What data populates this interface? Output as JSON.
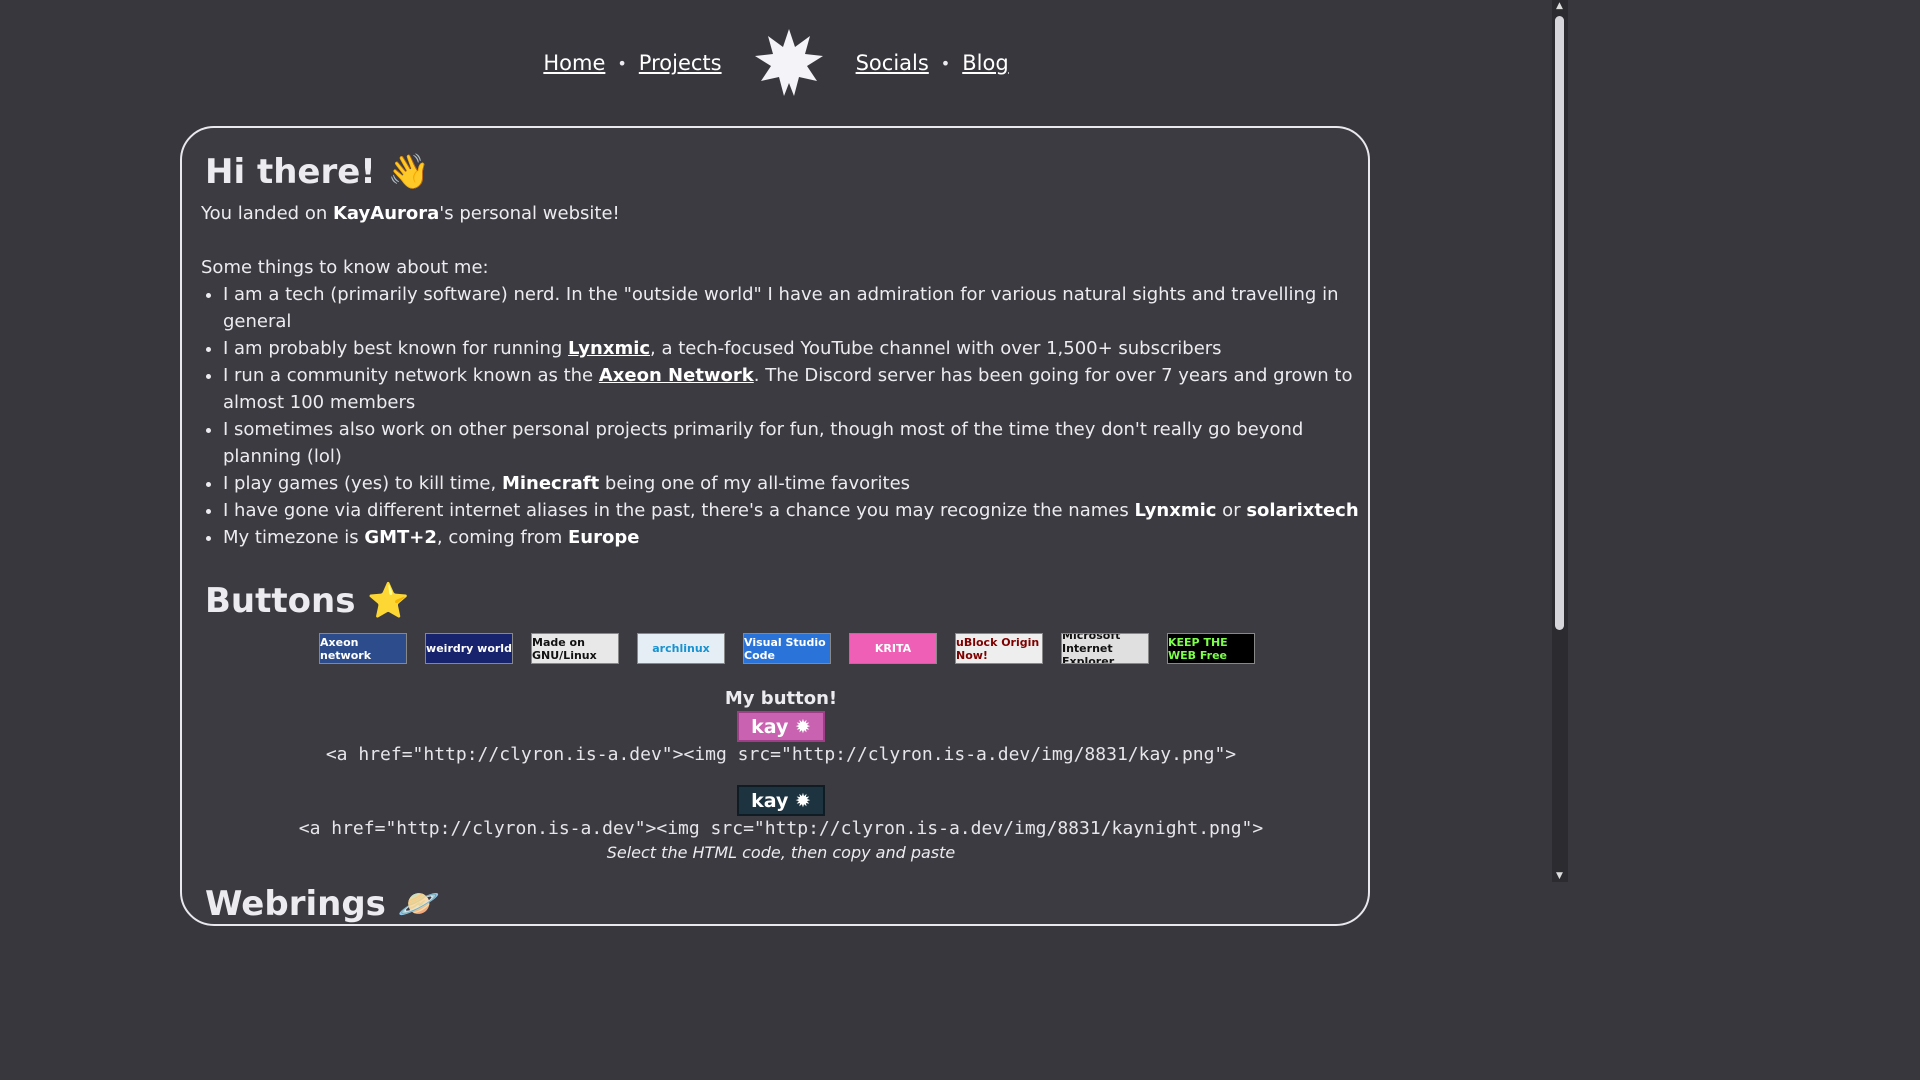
{
  "nav": {
    "home": "Home",
    "projects": "Projects",
    "socials": "Socials",
    "blog": "Blog",
    "separator": "•"
  },
  "intro": {
    "heading": "Hi there! 👋",
    "landed_prefix": "You landed on ",
    "name": "KayAurora",
    "landed_suffix": "'s personal website!",
    "things_label": "Some things to know about me:"
  },
  "facts": {
    "f1": "I am a tech (primarily software) nerd. In the \"outside world\" I have an admiration for various natural sights and travelling in general",
    "f2_a": "I am probably best known for running ",
    "f2_link": "Lynxmic",
    "f2_b": ", a tech-focused YouTube channel with over 1,500+ subscribers",
    "f3_a": "I run a community network known as the ",
    "f3_link": "Axeon Network",
    "f3_b": ". The Discord server has been going for over 7 years and grown to almost 100 members",
    "f4": "I sometimes also work on other personal projects primarily for fun, though most of the time they don't really go beyond planning (lol)",
    "f5_a": "I play games (yes) to kill time, ",
    "f5_b": "Minecraft",
    "f5_c": " being one of my all-time favorites",
    "f6_a": "I have gone via different internet aliases in the past, there's a chance you may recognize the names ",
    "f6_b": "Lynxmic",
    "f6_c": " or ",
    "f6_d": "solarixtech",
    "f7_a": "My timezone is ",
    "f7_b": "GMT+2",
    "f7_c": ", coming from ",
    "f7_d": "Europe"
  },
  "buttons": {
    "heading": "Buttons ⭐",
    "badges": [
      {
        "text": "Axeon network",
        "bg": "#2d4c8c",
        "fg": "#ffffff"
      },
      {
        "text": "weirdry world",
        "bg": "#18236e",
        "fg": "#ffffff"
      },
      {
        "text": "Made on GNU/Linux",
        "bg": "#e8e8e8",
        "fg": "#111111"
      },
      {
        "text": "archlinux",
        "bg": "#e6eef5",
        "fg": "#1793d1"
      },
      {
        "text": "Visual Studio Code",
        "bg": "#2a73d8",
        "fg": "#ffffff"
      },
      {
        "text": "KRITA",
        "bg": "#f05fb6",
        "fg": "#ffffff"
      },
      {
        "text": "uBlock Origin Now!",
        "bg": "#eeeeee",
        "fg": "#800000"
      },
      {
        "text": "Microsoft Internet Explorer",
        "bg": "#e0e0e0",
        "fg": "#111111"
      },
      {
        "text": "KEEP THE WEB Free",
        "bg": "#000000",
        "fg": "#7cff4a"
      }
    ],
    "my_button_title": "My button!",
    "kay_label": "kay ✹",
    "code_day": "<a href=\"http://clyron.is-a.dev\"><img src=\"http://clyron.is-a.dev/img/8831/kay.png\">",
    "code_night": "<a href=\"http://clyron.is-a.dev\"><img src=\"http://clyron.is-a.dev/img/8831/kaynight.png\">",
    "hint": "Select the HTML code, then copy and paste"
  },
  "webrings": {
    "heading": "Webrings 🪐"
  }
}
